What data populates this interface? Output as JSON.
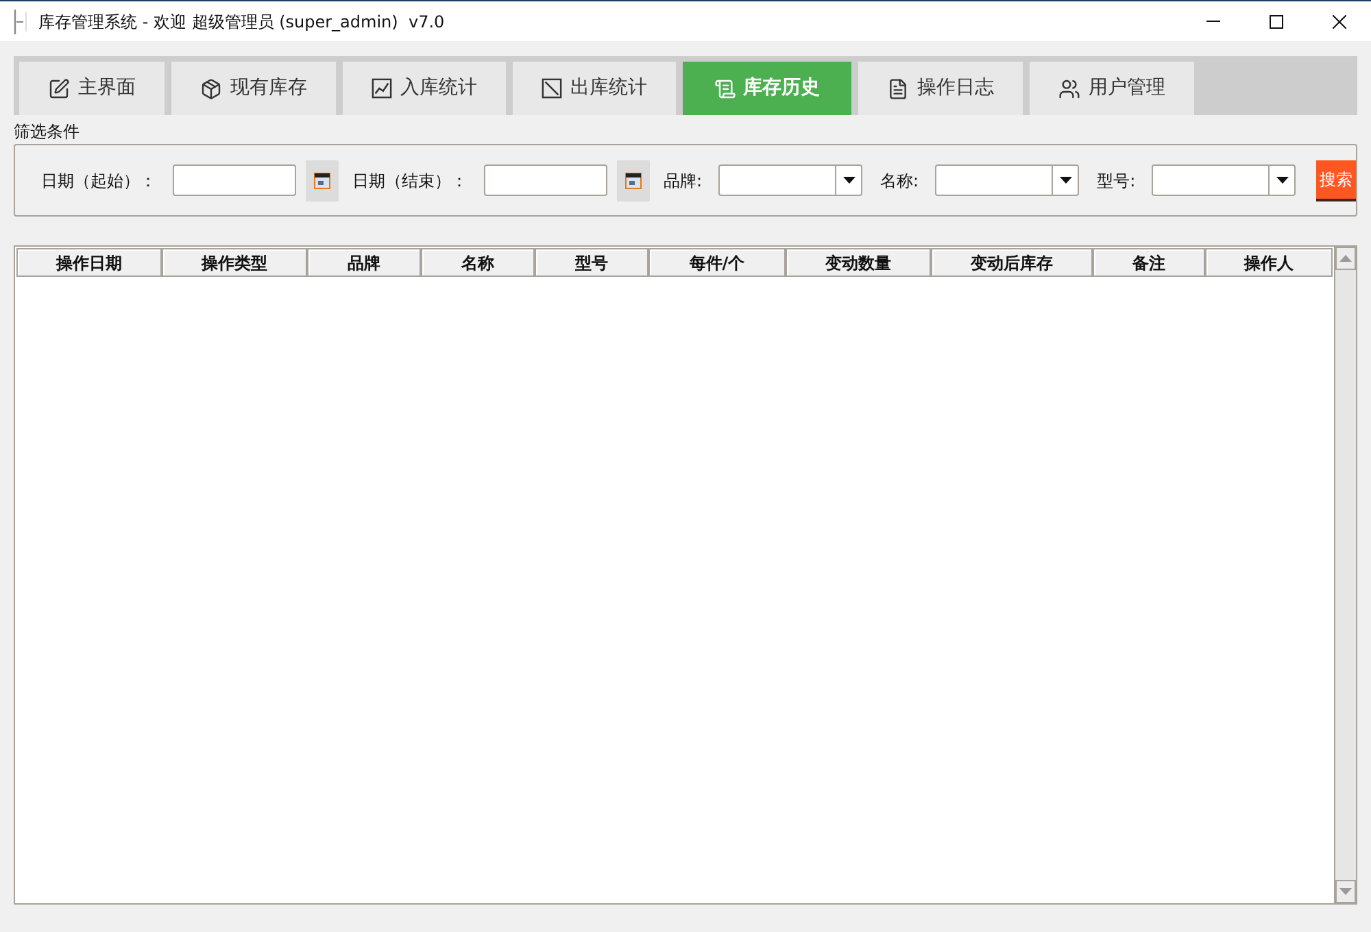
{
  "window": {
    "title": "库存管理系统 - 欢迎 超级管理员 (super_admin)  v7.0"
  },
  "tabs": [
    {
      "label": "主界面",
      "selected": false
    },
    {
      "label": "现有库存",
      "selected": false
    },
    {
      "label": "入库统计",
      "selected": false
    },
    {
      "label": "出库统计",
      "selected": false
    },
    {
      "label": "库存历史",
      "selected": true
    },
    {
      "label": "操作日志",
      "selected": false
    },
    {
      "label": "用户管理",
      "selected": false
    }
  ],
  "filter": {
    "title": "筛选条件",
    "fields": [
      {
        "kind": "date",
        "label": "日期（起始）："
      },
      {
        "kind": "date",
        "label": "日期（结束）："
      },
      {
        "kind": "select",
        "label": "品牌:"
      },
      {
        "kind": "select",
        "label": "名称:"
      },
      {
        "kind": "select",
        "label": "型号:"
      }
    ],
    "search_button": "搜索"
  },
  "table": {
    "columns": [
      "操作日期",
      "操作类型",
      "品牌",
      "名称",
      "型号",
      "每件/个",
      "变动数量",
      "变动后库存",
      "备注",
      "操作人"
    ]
  }
}
